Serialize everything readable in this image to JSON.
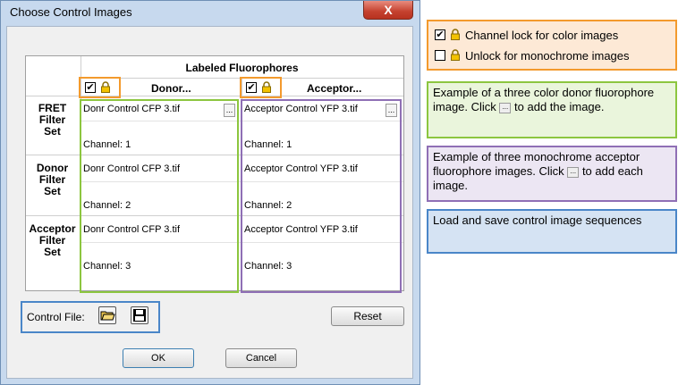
{
  "dialog": {
    "title": "Choose Control Images",
    "close_label": "X",
    "table": {
      "group_header": "Labeled Fluorophores",
      "columns": [
        {
          "label": "Donor..."
        },
        {
          "label": "Acceptor..."
        }
      ],
      "rows": [
        {
          "label_lines": [
            "FRET",
            "Filter",
            "Set"
          ],
          "donor": {
            "file": "Donr Control CFP 3.tif",
            "channel": "Channel: 1"
          },
          "acceptor": {
            "file": "Acceptor Control YFP 3.tif",
            "channel": "Channel: 1"
          }
        },
        {
          "label_lines": [
            "Donor",
            "Filter",
            "Set"
          ],
          "donor": {
            "file": "Donr Control CFP 3.tif",
            "channel": "Channel: 2"
          },
          "acceptor": {
            "file": "Acceptor Control YFP 3.tif",
            "channel": "Channel: 2"
          }
        },
        {
          "label_lines": [
            "Acceptor",
            "Filter",
            "Set"
          ],
          "donor": {
            "file": "Donr Control CFP 3.tif",
            "channel": "Channel: 3"
          },
          "acceptor": {
            "file": "Acceptor Control YFP 3.tif",
            "channel": "Channel: 3"
          }
        }
      ],
      "ellipsis": "..."
    },
    "control_file_label": "Control File:",
    "reset_label": "Reset",
    "ok_label": "OK",
    "cancel_label": "Cancel"
  },
  "legend": {
    "lock_text": "Channel lock for color images",
    "unlock_text": "Unlock for monochrome images",
    "green_text_1": "Example of a three color donor fluorophore image. Click",
    "green_text_2": "to add the image.",
    "purple_text_1": "Example of three monochrome acceptor fluorophore images. Click",
    "purple_text_2": "to add each image.",
    "blue_text": "Load and save control image sequences"
  },
  "colors": {
    "orange": "#f39a2d",
    "green": "#8cc63f",
    "purple": "#8f6fb5",
    "blue": "#4a86c8"
  },
  "icons": [
    "close-icon",
    "checkbox-checked-icon",
    "lock-icon",
    "open-folder-icon",
    "save-disk-icon"
  ]
}
